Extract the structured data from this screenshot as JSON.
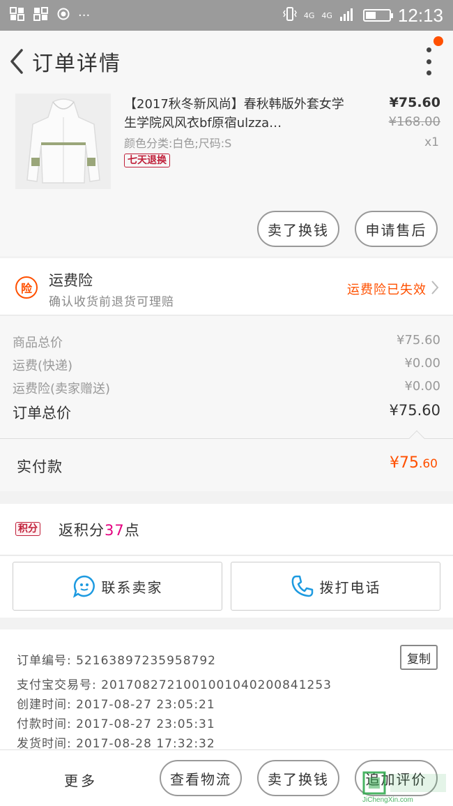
{
  "status_bar": {
    "network_left": "4G",
    "network_right": "4G",
    "time": "12:13",
    "battery_level": 0.45
  },
  "nav": {
    "title": "订单详情",
    "back_icon": "chevron-left-icon",
    "more_icon": "more-vertical-icon",
    "accent": "#ff5000"
  },
  "product": {
    "title": "【2017秋冬新风尚】春秋韩版外套女学生学院风风衣bf原宿ulzza…",
    "sku": "颜色分类:白色;尺码:S",
    "tag": "七天退换",
    "price": "¥75.60",
    "original_price": "¥168.00",
    "quantity": "x1",
    "btn_resell": "卖了换钱",
    "btn_aftersale": "申请售后"
  },
  "insurance": {
    "icon_text": "险",
    "title": "运费险",
    "subtitle": "确认收货前退货可理赔",
    "status": "运费险已失效"
  },
  "breakdown": {
    "rows": [
      {
        "label": "商品总价",
        "value": "¥75.60"
      },
      {
        "label": "运费(快递)",
        "value": "¥0.00"
      },
      {
        "label": "运费险(卖家赠送)",
        "value": "¥0.00"
      }
    ],
    "total_label": "订单总价",
    "total_value": "¥75.60"
  },
  "paid": {
    "label": "实付款",
    "currency": "¥",
    "integer": "75",
    "decimal": ".60"
  },
  "points": {
    "badge": "积分",
    "prefix": "返积分",
    "amount": "37",
    "suffix": "点"
  },
  "contact": {
    "seller": "联系卖家",
    "phone": "拨打电话"
  },
  "order_info": {
    "order_no": "订单编号: 52163897235958792",
    "alipay_no": "支付宝交易号: 2017082721001001040200841253",
    "created": "创建时间: 2017-08-27 23:05:21",
    "paid": "付款时间: 2017-08-27 23:05:31",
    "shipped": "发货时间: 2017-08-28 17:32:32",
    "copy": "复制"
  },
  "bottom_bar": {
    "more": "更多",
    "logistics": "查看物流",
    "resell": "卖了换钱",
    "review": "追加评价"
  },
  "watermark": {
    "text": "JiChengXin.com"
  }
}
